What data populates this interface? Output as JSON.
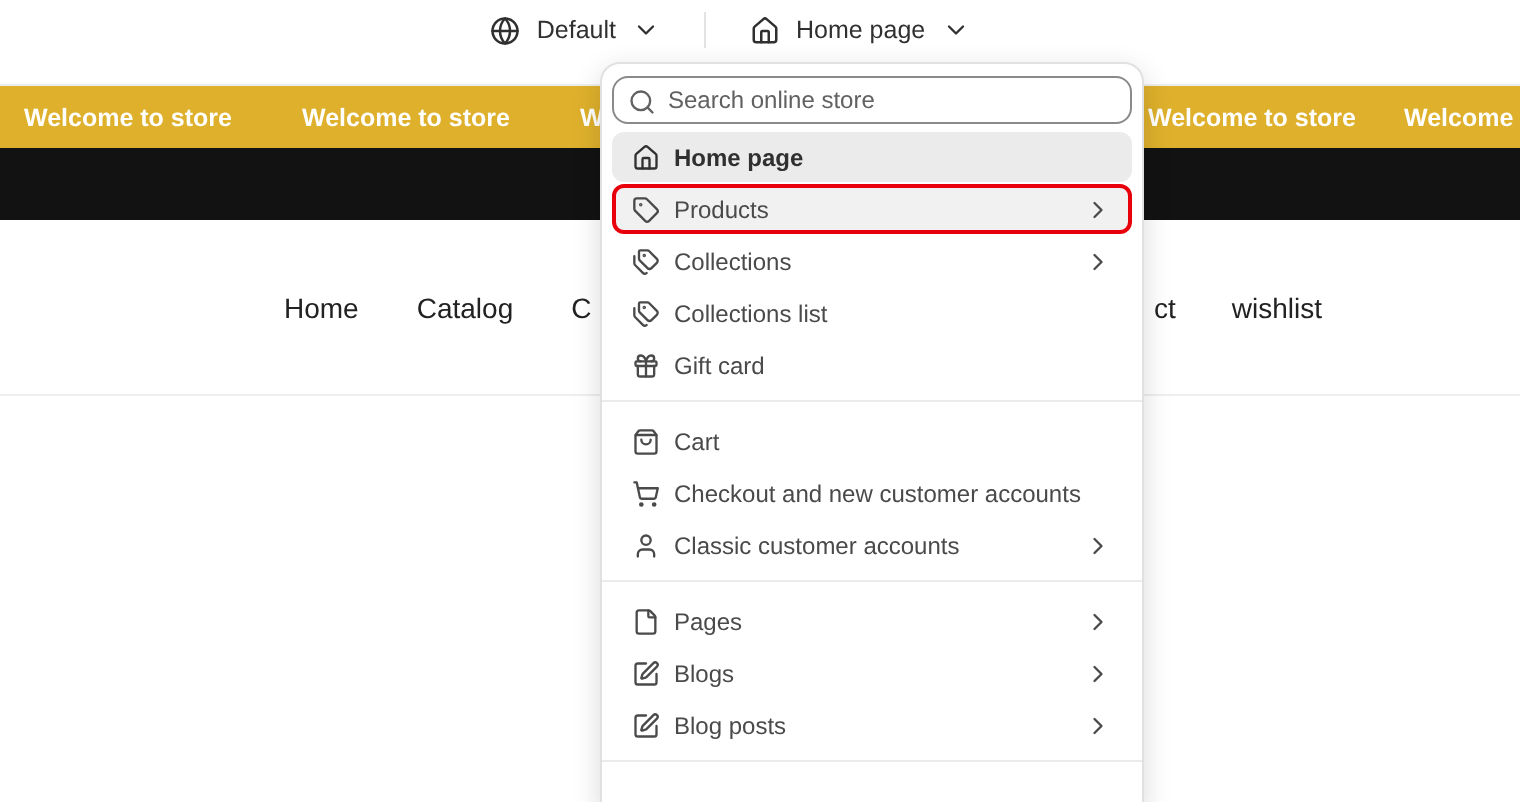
{
  "top_bar": {
    "theme_selector": {
      "label": "Default"
    },
    "page_selector": {
      "label": "Home page"
    }
  },
  "announcement_bar": {
    "left_items": [
      "Welcome to store",
      "Welcome to store",
      "W"
    ],
    "right_items": [
      "Welcome to store",
      "Welcome"
    ]
  },
  "navigation": {
    "left_items": [
      "Home",
      "Catalog",
      "C"
    ],
    "right_items": [
      "ct",
      "wishlist"
    ]
  },
  "page_menu": {
    "search": {
      "placeholder": "Search online store"
    },
    "groups": [
      {
        "items": [
          {
            "label": "Home page",
            "selected": true,
            "highlighted": false,
            "has_submenu": false
          },
          {
            "label": "Products",
            "selected": false,
            "highlighted": true,
            "has_submenu": true
          },
          {
            "label": "Collections",
            "selected": false,
            "highlighted": false,
            "has_submenu": true
          },
          {
            "label": "Collections list",
            "selected": false,
            "highlighted": false,
            "has_submenu": false
          },
          {
            "label": "Gift card",
            "selected": false,
            "highlighted": false,
            "has_submenu": false
          }
        ]
      },
      {
        "items": [
          {
            "label": "Cart",
            "selected": false,
            "highlighted": false,
            "has_submenu": false
          },
          {
            "label": "Checkout and new customer accounts",
            "selected": false,
            "highlighted": false,
            "has_submenu": false
          },
          {
            "label": "Classic customer accounts",
            "selected": false,
            "highlighted": false,
            "has_submenu": true
          }
        ]
      },
      {
        "items": [
          {
            "label": "Pages",
            "selected": false,
            "highlighted": false,
            "has_submenu": true
          },
          {
            "label": "Blogs",
            "selected": false,
            "highlighted": false,
            "has_submenu": true
          },
          {
            "label": "Blog posts",
            "selected": false,
            "highlighted": false,
            "has_submenu": true
          }
        ]
      }
    ]
  }
}
